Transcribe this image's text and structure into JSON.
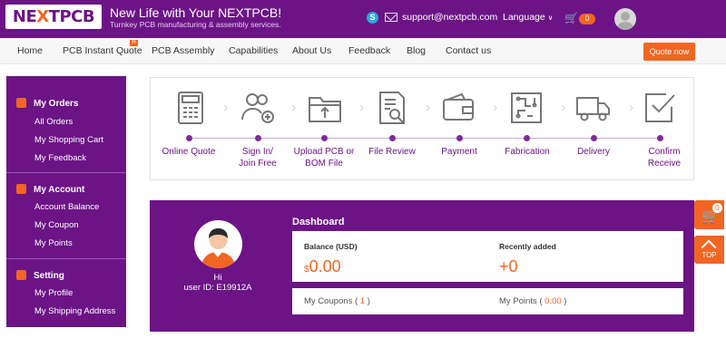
{
  "header": {
    "logo": "NEXTPCB",
    "tagline": "New Life with Your NEXTPCB!",
    "subtagline": "Turnkey PCB manufacturing & assembly services.",
    "email": "support@nextpcb.com",
    "language": "Language",
    "cart_count": "0",
    "skype_glyph": "S"
  },
  "nav": {
    "items": [
      "Home",
      "PCB Instant Quote",
      "PCB Assembly",
      "Capabilities",
      "About Us",
      "Feedback",
      "Blog",
      "Contact us"
    ],
    "hot_badge": "H",
    "quote_button": "Quote now"
  },
  "sidebar": {
    "orders": {
      "title": "My Orders",
      "links": [
        "All Orders",
        "My Shopping Cart",
        "My Feedback"
      ]
    },
    "account": {
      "title": "My Account",
      "links": [
        "Account Balance",
        "My Coupon",
        "My Points"
      ]
    },
    "setting": {
      "title": "Setting",
      "links": [
        "My Profile",
        "My Shipping Address"
      ]
    }
  },
  "steps": [
    {
      "label": "Online Quote",
      "icon": "calculator-icon"
    },
    {
      "label": "Sign In/\nJoin Free",
      "icon": "users-add-icon"
    },
    {
      "label": "Upload PCB or\nBOM File",
      "icon": "folder-upload-icon"
    },
    {
      "label": "File Review",
      "icon": "document-search-icon"
    },
    {
      "label": "Payment",
      "icon": "wallet-icon"
    },
    {
      "label": "Fabrication",
      "icon": "circuit-board-icon"
    },
    {
      "label": "Delivery",
      "icon": "truck-icon"
    },
    {
      "label": "Confirm\nReceive",
      "icon": "checkmark-icon"
    }
  ],
  "dashboard": {
    "title": "Dashboard",
    "greeting": "Hi",
    "user_id": "user ID: E19912A",
    "balance_label": "Balance (USD)",
    "balance_currency": "$",
    "balance_value": "0.00",
    "recent_label": "Recently added",
    "recent_value": "+0",
    "coupons_label": "My Coupons",
    "coupons_count": "1",
    "points_label": "My Points",
    "points_value": "0.00"
  },
  "floating": {
    "cart_count": "0",
    "top_label": "TOP"
  },
  "colors": {
    "brand_purple": "#6c1486",
    "accent_orange": "#f26522"
  }
}
